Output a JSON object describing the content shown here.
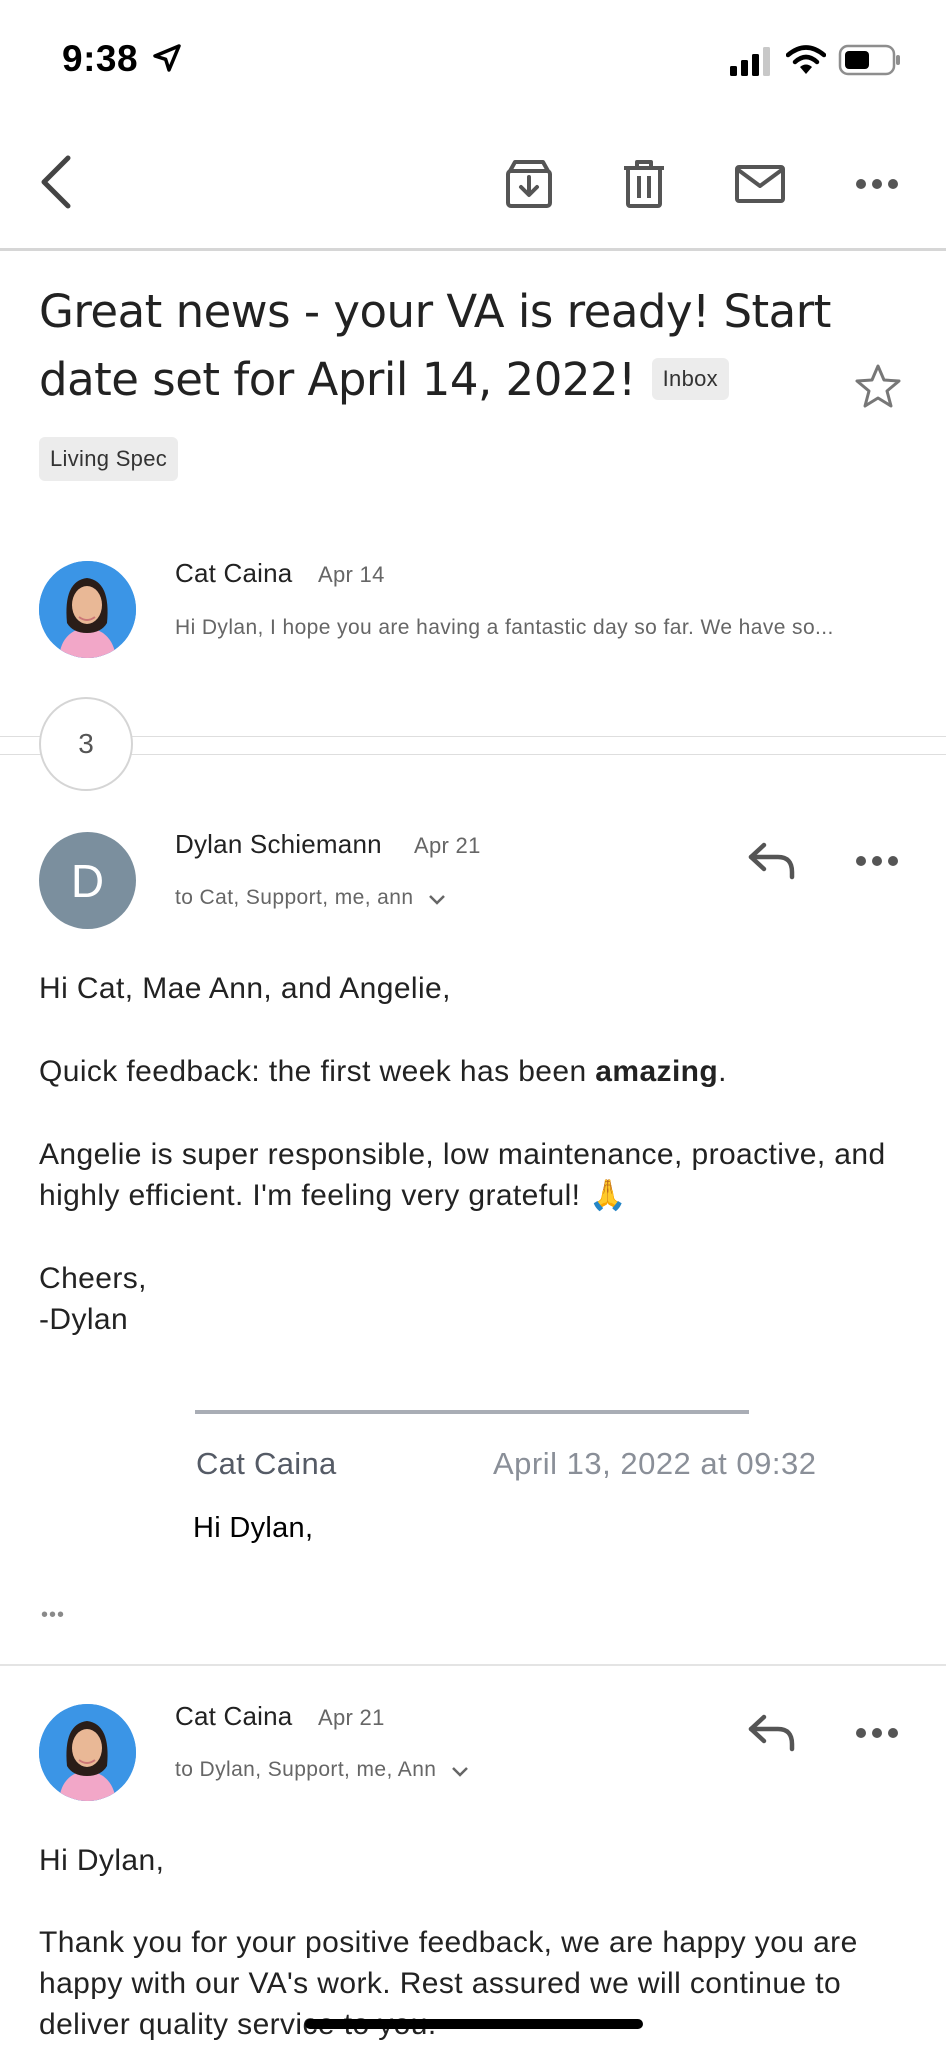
{
  "status_bar": {
    "time": "9:38"
  },
  "subject": {
    "text": "Great news - your VA is ready! Start date set for April 14, 2022!",
    "inbox_label": "Inbox"
  },
  "label": "Living Spec",
  "collapsed_message": {
    "sender": "Cat Caina",
    "date": "Apr 14",
    "snippet": "Hi Dylan, I hope you are having a fantastic day so far. We have so..."
  },
  "hidden_count": "3",
  "message_1": {
    "avatar_letter": "D",
    "sender": "Dylan Schiemann",
    "date": "Apr 21",
    "recipients": "to Cat, Support, me, ann",
    "greeting": "Hi Cat, Mae Ann, and Angelie,",
    "para1_prefix": "Quick feedback: the first week has been ",
    "para1_bold": "amazing",
    "para1_suffix": ".",
    "para2": "Angelie is super responsible, low maintenance, proactive, and highly efficient. I'm feeling very grateful! 🙏",
    "signoff_1": "Cheers,",
    "signoff_2": "-Dylan",
    "quote_sender": "Cat Caina",
    "quote_date": "April 13, 2022 at 09:32",
    "quote_body": "Hi Dylan,",
    "more_glyph": "•••"
  },
  "message_2": {
    "sender": "Cat Caina",
    "date": "Apr 21",
    "recipients": "to Dylan, Support, me, Ann",
    "greeting": "Hi Dylan,",
    "body": "Thank you for your positive feedback, we are happy you are happy with our VA's work. Rest assured we will continue to deliver quality service to you."
  },
  "colors": {
    "avatar_d_bg": "#7b8f9e",
    "avatar_photo_bg": "#3b95e6"
  }
}
